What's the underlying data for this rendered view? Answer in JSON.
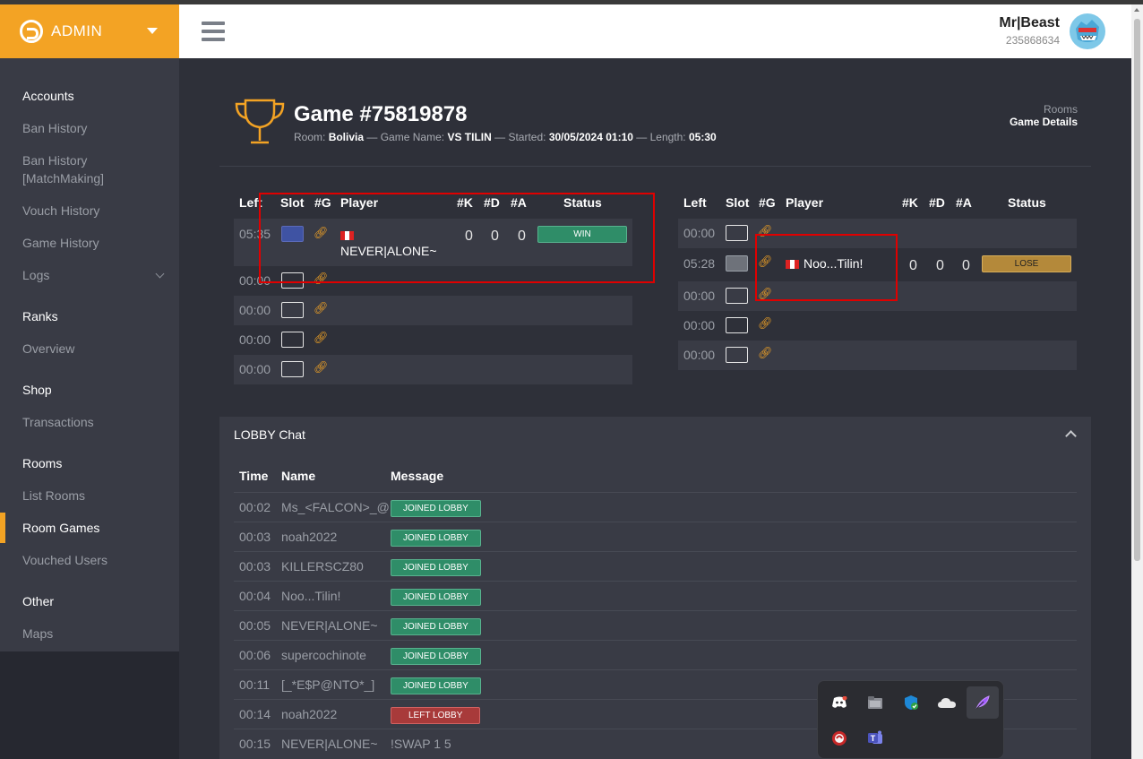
{
  "brand": {
    "title": "ADMIN"
  },
  "user": {
    "name": "Mr|Beast",
    "id": "235868634"
  },
  "sidebar": {
    "sections": [
      {
        "title": "Accounts",
        "items": [
          "Ban History",
          "Ban History [MatchMaking]",
          "Vouch History",
          "Game History",
          "Logs"
        ]
      },
      {
        "title": "Ranks",
        "items": [
          "Overview"
        ]
      },
      {
        "title": "Shop",
        "items": [
          "Transactions"
        ]
      },
      {
        "title": "Rooms",
        "items": [
          "List Rooms",
          "Room Games",
          "Vouched Users"
        ]
      },
      {
        "title": "Other",
        "items": [
          "Maps"
        ]
      }
    ],
    "active": "Room Games"
  },
  "breadcrumb": {
    "parent": "Rooms",
    "current": "Game Details"
  },
  "game": {
    "title": "Game #75819878",
    "room_label": "Room:",
    "room": "Bolivia",
    "name_label": "— Game Name:",
    "name": "VS TILIN",
    "started_label": "— Started:",
    "started": "30/05/2024 01:10",
    "length_label": "— Length:",
    "length": "05:30"
  },
  "columns": {
    "left": "Left",
    "slot": "Slot",
    "g": "#G",
    "player": "Player",
    "k": "#K",
    "d": "#D",
    "a": "#A",
    "status": "Status"
  },
  "team1": {
    "rows": [
      {
        "left": "05:35",
        "player": "NEVER|ALONE~",
        "k": "0",
        "d": "0",
        "a": "0",
        "status": "WIN"
      },
      {
        "left": "00:00"
      },
      {
        "left": "00:00"
      },
      {
        "left": "00:00"
      },
      {
        "left": "00:00"
      }
    ]
  },
  "team2": {
    "rows": [
      {
        "left": "00:00"
      },
      {
        "left": "05:28",
        "player": "Noo...Tilin!",
        "k": "0",
        "d": "0",
        "a": "0",
        "status": "LOSE"
      },
      {
        "left": "00:00"
      },
      {
        "left": "00:00"
      },
      {
        "left": "00:00"
      }
    ]
  },
  "chat": {
    "title": "LOBBY Chat",
    "headers": {
      "time": "Time",
      "name": "Name",
      "message": "Message"
    },
    "rows": [
      {
        "time": "00:02",
        "name": "Ms_<FALCON>_@",
        "message": "JOINED LOBBY"
      },
      {
        "time": "00:03",
        "name": "noah2022",
        "message": "JOINED LOBBY"
      },
      {
        "time": "00:03",
        "name": "KILLERSCZ80",
        "message": "JOINED LOBBY"
      },
      {
        "time": "00:04",
        "name": "Noo...Tilin!",
        "message": "JOINED LOBBY"
      },
      {
        "time": "00:05",
        "name": "NEVER|ALONE~",
        "message": "JOINED LOBBY"
      },
      {
        "time": "00:06",
        "name": "supercochinote",
        "message": "JOINED LOBBY"
      },
      {
        "time": "00:11",
        "name": "[_*E$P@NTO*_]",
        "message": "JOINED LOBBY"
      },
      {
        "time": "00:14",
        "name": "noah2022",
        "message": "LEFT LOBBY"
      },
      {
        "time": "00:15",
        "name": "NEVER|ALONE~",
        "message": "!SWAP 1 5"
      }
    ]
  },
  "tray": {
    "icons": [
      "discord-icon",
      "files-icon",
      "defender-icon",
      "onedrive-icon",
      "feather-app-icon",
      "security-app-icon",
      "teams-icon"
    ]
  },
  "colors": {
    "accent": "#f3a324",
    "win": "#2f8d68",
    "lose": "#b4893a",
    "left": "#a83a3a"
  }
}
